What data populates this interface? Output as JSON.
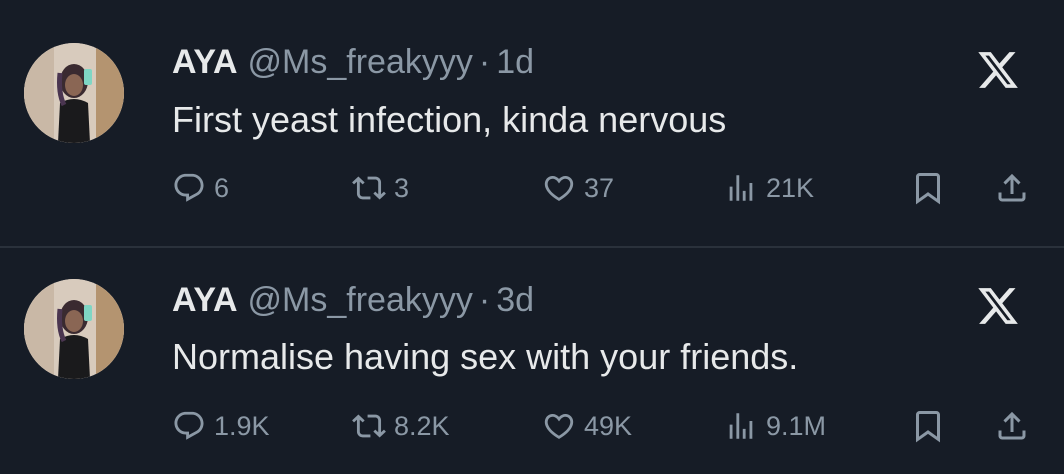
{
  "tweets": [
    {
      "name": "AYA",
      "handle": "@Ms_freakyyy",
      "separator": "·",
      "time": "1d",
      "text": "First yeast infection, kinda nervous",
      "replies": "6",
      "reposts": "3",
      "likes": "37",
      "views": "21K"
    },
    {
      "name": "AYA",
      "handle": "@Ms_freakyyy",
      "separator": "·",
      "time": "3d",
      "text": "Normalise having sex with your friends.",
      "replies": "1.9K",
      "reposts": "8.2K",
      "likes": "49K",
      "views": "9.1M"
    }
  ],
  "icons": {
    "brand": "x-logo-icon",
    "reply": "reply-icon",
    "repost": "repost-icon",
    "like": "heart-icon",
    "views": "views-icon",
    "bookmark": "bookmark-icon",
    "share": "share-icon"
  },
  "colors": {
    "background": "#161c26",
    "primary_text": "#e7e9ea",
    "secondary_text": "#8b98a5",
    "divider": "#2a313b"
  }
}
